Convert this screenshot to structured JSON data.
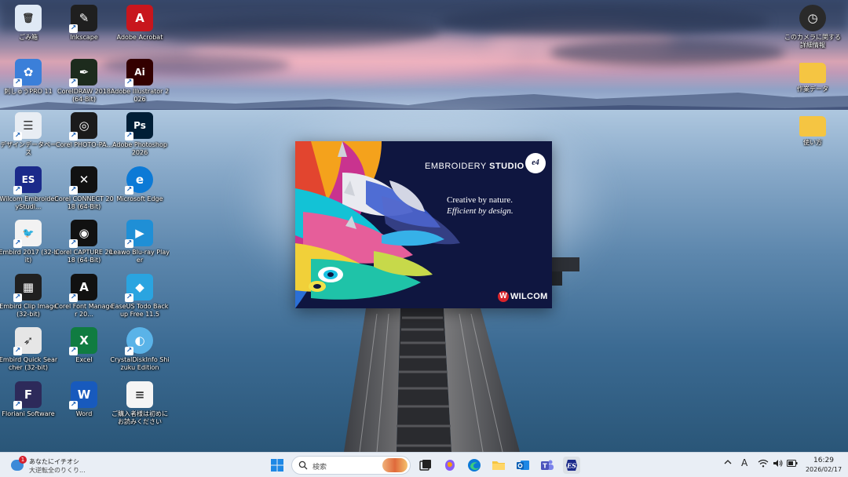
{
  "desktop": {
    "icons_left": [
      {
        "label": "ごみ箱",
        "icon": "recycle-bin-icon",
        "color": "#dfe9f5"
      },
      {
        "label": "Inkscape",
        "icon": "inkscape-icon",
        "color": "#1f1f1f"
      },
      {
        "label": "Adobe Acrobat",
        "icon": "acrobat-icon",
        "color": "#c8161d"
      },
      {
        "label": "刺しゅうPRO 11",
        "icon": "embroidery-pro-icon",
        "color": "#3b7fd9"
      },
      {
        "label": "CorelDRAW 2018 (64-Bit)",
        "icon": "coreldraw-icon",
        "color": "#1d2b1d"
      },
      {
        "label": "Adobe Illustrator 2026",
        "icon": "illustrator-icon",
        "color": "#330000"
      },
      {
        "label": "デザインデータベース",
        "icon": "design-database-icon",
        "color": "#e8edf3"
      },
      {
        "label": "Corel PHOTO-PA...",
        "icon": "photo-paint-icon",
        "color": "#1b1b1b"
      },
      {
        "label": "Adobe Photoshop 2026",
        "icon": "photoshop-icon",
        "color": "#001e36"
      },
      {
        "label": "Wilcom EmbroideryStudi...",
        "icon": "wilcom-es-icon",
        "color": "#1b2a8a"
      },
      {
        "label": "Corel CONNECT 2018 (64-Bit)",
        "icon": "corel-connect-icon",
        "color": "#111111"
      },
      {
        "label": "Microsoft Edge",
        "icon": "edge-icon",
        "color": "#0c7ad6"
      },
      {
        "label": "Embird 2017 (32-bit)",
        "icon": "embird-icon",
        "color": "#f2f2f2"
      },
      {
        "label": "Corel CAPTURE 2018 (64-Bit)",
        "icon": "corel-capture-icon",
        "color": "#111111"
      },
      {
        "label": "Leawo Blu-ray Player",
        "icon": "leawo-icon",
        "color": "#1f8fd6"
      },
      {
        "label": "Embird Clip Image (32-bit)",
        "icon": "embird-clip-icon",
        "color": "#202020"
      },
      {
        "label": "Corel Font Manager 20...",
        "icon": "corel-font-icon",
        "color": "#111111"
      },
      {
        "label": "EaseUS Todo Backup Free 11.5",
        "icon": "easeus-icon",
        "color": "#2aa4e0"
      },
      {
        "label": "Embird Quick Searcher (32-bit)",
        "icon": "embird-quick-icon",
        "color": "#e6e6e6"
      },
      {
        "label": "Excel",
        "icon": "excel-icon",
        "color": "#107c41"
      },
      {
        "label": "CrystalDiskInfo Shizuku Edition",
        "icon": "crystaldiskinfo-icon",
        "color": "#5ab3e8"
      },
      {
        "label": "Floriani Software",
        "icon": "floriani-icon",
        "color": "#2d2a5a"
      },
      {
        "label": "Word",
        "icon": "word-icon",
        "color": "#185abd"
      },
      {
        "label": "ご購入者様は初めにお読みください",
        "icon": "text-file-icon",
        "color": "#f5f5f5"
      }
    ],
    "icons_right": [
      {
        "label": "このカメラに関する詳細情報",
        "icon": "camera-info-icon",
        "color": "#2a2a2a"
      },
      {
        "label": "作業データ",
        "icon": "folder-icon",
        "color": "#f5c542"
      },
      {
        "label": "使い方",
        "icon": "folder-icon",
        "color": "#f5c542"
      }
    ]
  },
  "splash": {
    "brand_prefix": "EMBROIDERY",
    "brand_suffix": "STUDIO",
    "version": "e4",
    "tagline1": "Creative by nature.",
    "tagline2": "Efficient by design.",
    "company": "WILCOM",
    "company_mark": "W",
    "bg_color": "#0f1640"
  },
  "taskbar": {
    "widget_title": "あなたにイチオシ",
    "widget_subtitle": "大逆転全のりくり...",
    "widget_badge": "1",
    "search_placeholder": "検索",
    "ime_label": "A",
    "time": "16:29",
    "date": "2026/02/17"
  }
}
